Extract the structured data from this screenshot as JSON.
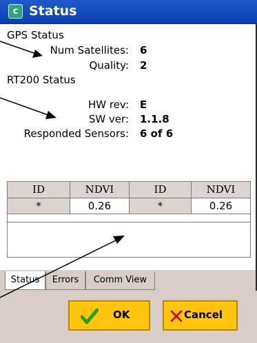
{
  "window": {
    "title": "Status"
  },
  "gps": {
    "section_label": "GPS Status",
    "num_satellites_label": "Num Satellites:",
    "num_satellites_value": "6",
    "quality_label": "Quality:",
    "quality_value": "2"
  },
  "rt200": {
    "section_label": "RT200 Status",
    "hw_rev_label": "HW rev:",
    "hw_rev_value": "E",
    "sw_ver_label": "SW ver:",
    "sw_ver_value": "1.1.8",
    "responded_label": "Responded Sensors:",
    "responded_value": "6 of 6"
  },
  "table": {
    "columns": [
      "ID",
      "NDVI",
      "ID",
      "NDVI"
    ],
    "rows": [
      [
        "*",
        "0.26",
        "*",
        "0.26"
      ]
    ]
  },
  "tabs": [
    {
      "label": "Status",
      "active": true
    },
    {
      "label": "Errors",
      "active": false
    },
    {
      "label": "Comm View",
      "active": false
    }
  ],
  "buttons": {
    "ok_label": "OK",
    "cancel_label": "Cancel"
  },
  "colors": {
    "titlebar": "#1549bd",
    "button_fill": "#ffc40d",
    "panel_bg": "#d8ccc6",
    "ok_check": "#2f9a18",
    "cancel_x": "#c40000"
  },
  "icons": {
    "app": "app-icon",
    "ok": "checkmark-icon",
    "cancel": "x-icon"
  }
}
